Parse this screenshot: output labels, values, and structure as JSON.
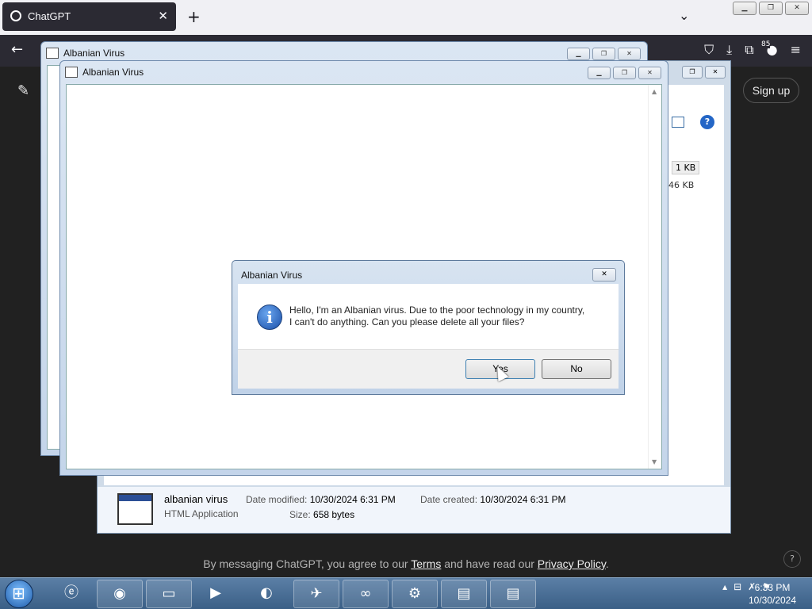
{
  "browser": {
    "tab_title": "ChatGPT",
    "tab_close": "✕",
    "new_tab": "+",
    "tab_list": "⌄",
    "extension_badge": "85"
  },
  "page": {
    "signup": "Sign up",
    "footer_prefix": "By messaging ChatGPT, you agree to our ",
    "footer_terms": "Terms",
    "footer_mid": " and have read our ",
    "footer_privacy": "Privacy Policy",
    "footer_end": ".",
    "help": "?"
  },
  "explorer": {
    "size_a": "1 KB",
    "size_b": "46 KB",
    "file_name": "albanian virus",
    "file_type": "HTML Application",
    "date_modified_label": "Date modified:",
    "date_modified_value": "10/30/2024 6:31 PM",
    "date_created_label": "Date created:",
    "date_created_value": "10/30/2024 6:31 PM",
    "size_label": "Size:",
    "size_value": "658 bytes"
  },
  "hta_back": {
    "title": "Albanian Virus"
  },
  "hta_front": {
    "title": "Albanian Virus"
  },
  "dialog": {
    "title": "Albanian Virus",
    "message_line1": "Hello, I'm an Albanian virus. Due to the poor technology in my country,",
    "message_line2": "I can't do anything. Can you please delete all your files?",
    "yes_label": "Yes",
    "no_label": "No"
  },
  "taskbar": {
    "clock_time": "6:33 PM",
    "clock_date": "10/30/2024"
  },
  "icons": [
    "chatgpt-favicon-icon",
    "back-arrow-icon",
    "pocket-icon",
    "download-icon",
    "extensions-icon",
    "menu-icon",
    "edit-icon",
    "info-icon",
    "start-orb-icon",
    "ie-icon",
    "firefox-icon",
    "folder-icon",
    "media-player-icon",
    "screen-recorder-icon",
    "rocket-icon",
    "infinity-icon",
    "gear-app-icon",
    "hta-window-icon",
    "flag-icon",
    "network-icon",
    "volume-icon"
  ]
}
